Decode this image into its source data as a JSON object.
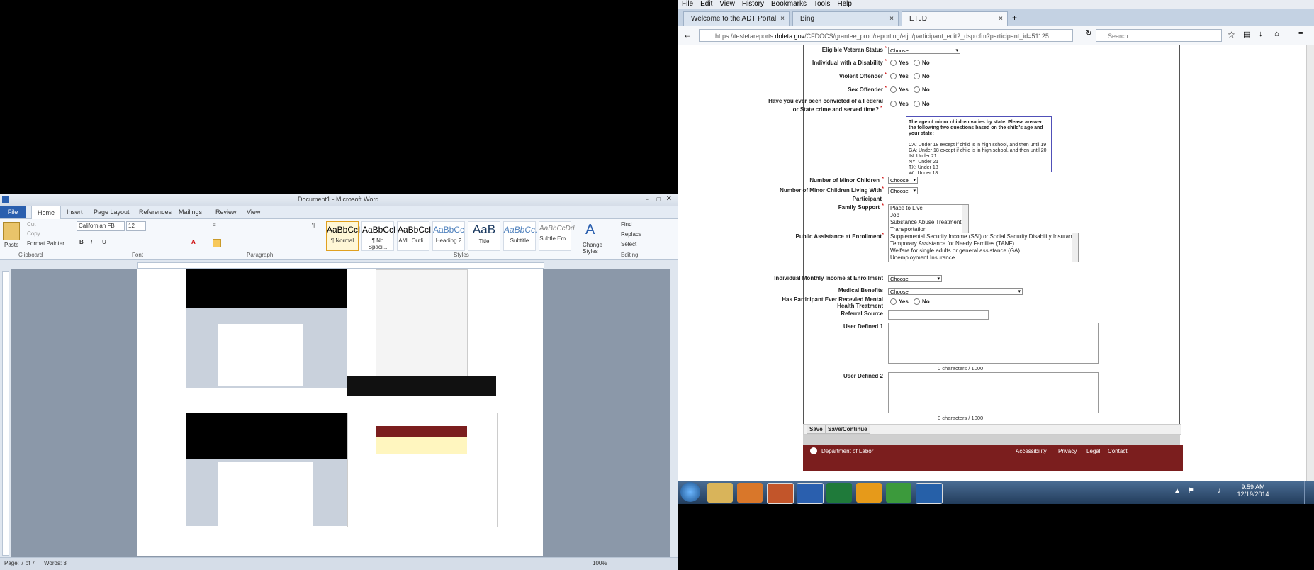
{
  "word": {
    "title": "Document1 - Microsoft Word",
    "tabs": [
      "File",
      "Home",
      "Insert",
      "Page Layout",
      "References",
      "Mailings",
      "Review",
      "View"
    ],
    "clipboard": {
      "paste": "Paste",
      "cut": "Cut",
      "copy": "Copy",
      "format_painter": "Format Painter",
      "label": "Clipboard"
    },
    "font": {
      "name": "Californian FB",
      "size": "12",
      "label": "Font"
    },
    "paragraph_label": "Paragraph",
    "styles": [
      {
        "sample": "AaBbCcI",
        "name": "¶ Normal"
      },
      {
        "sample": "AaBbCcI",
        "name": "¶ No Spaci..."
      },
      {
        "sample": "AaBbCcI",
        "name": "AML Outli..."
      },
      {
        "sample": "AaBbCc",
        "name": "Heading 2"
      },
      {
        "sample": "AaB",
        "name": "Title"
      },
      {
        "sample": "AaBbCc.",
        "name": "Subtitle"
      },
      {
        "sample": "AaBbCcDd",
        "name": "Subtle Em..."
      }
    ],
    "styles_label": "Styles",
    "change_styles": "Change Styles",
    "editing": {
      "find": "Find",
      "replace": "Replace",
      "select": "Select",
      "label": "Editing"
    },
    "status": {
      "page": "Page: 7 of 7",
      "words": "Words: 3",
      "zoom": "100%"
    }
  },
  "browser": {
    "menu": [
      "File",
      "Edit",
      "View",
      "History",
      "Bookmarks",
      "Tools",
      "Help"
    ],
    "tabs": [
      "Welcome to the ADT Portal",
      "Bing",
      "ETJD"
    ],
    "url_prefix": "https://testetareports.",
    "url_domain": "doleta.gov",
    "url_rest": "/CFDOCS/grantee_prod/reporting/etjd/participant_edit2_dsp.cfm?participant_id=51125",
    "search_placeholder": "Search"
  },
  "form": {
    "veteran": {
      "label": "Eligible Veteran Status",
      "value": "Choose"
    },
    "disability": {
      "label": "Individual with a Disability"
    },
    "violent": {
      "label": "Violent Offender"
    },
    "sex": {
      "label": "Sex Offender"
    },
    "convicted": {
      "label1": "Have you ever been convicted of a Federal",
      "label2": "or State crime and served time?"
    },
    "yes": "Yes",
    "no": "No",
    "info": {
      "heading": "The age of minor children varies by state. Please answer the following two questions based on the child's age and your state:",
      "lines": [
        "CA: Under 18 except if child is in high school, and then until 19",
        "GA: Under 18 except if child is in high school, and then until 20",
        "IN: Under 21",
        "NY: Under 21",
        "TX: Under 18",
        "WI: Under 18"
      ]
    },
    "minor_children": {
      "label": "Number of Minor Children",
      "value": "Choose"
    },
    "minor_living": {
      "label1": "Number of Minor Children Living With",
      "label2": "Participant",
      "value": "Choose"
    },
    "family_support": {
      "label": "Family Support",
      "options": [
        "Place to Live",
        "Job",
        "Substance Abuse Treatment",
        "Transportation"
      ]
    },
    "public_assistance": {
      "label": "Public Assistance at Enrollment",
      "options": [
        "Supplemental Security Income (SSI) or Social Security Disability Insurance",
        "Temporary Assistance for Needy Families (TANF)",
        "Welfare for single adults or general assistance (GA)",
        "Unemployment Insurance"
      ]
    },
    "income": {
      "label": "Individual Monthly Income at Enrollment",
      "value": "Choose"
    },
    "medical": {
      "label": "Medical Benefits",
      "value": "Choose"
    },
    "mental": {
      "label1": "Has Participant Ever Recevied Mental",
      "label2": "Health Treatment"
    },
    "referral": {
      "label": "Referral Source"
    },
    "ud1": {
      "label": "User Defined 1",
      "counter": "0 characters / 1000"
    },
    "ud2": {
      "label": "User Defined 2",
      "counter": "0 characters / 1000"
    },
    "save": "Save",
    "save_continue": "Save/Continue",
    "footer": {
      "dept": "Department of Labor",
      "links": [
        "Accessibility",
        "Privacy",
        "Legal",
        "Contact"
      ]
    }
  },
  "taskbar": {
    "time": "9:59 AM",
    "date": "12/19/2014"
  }
}
